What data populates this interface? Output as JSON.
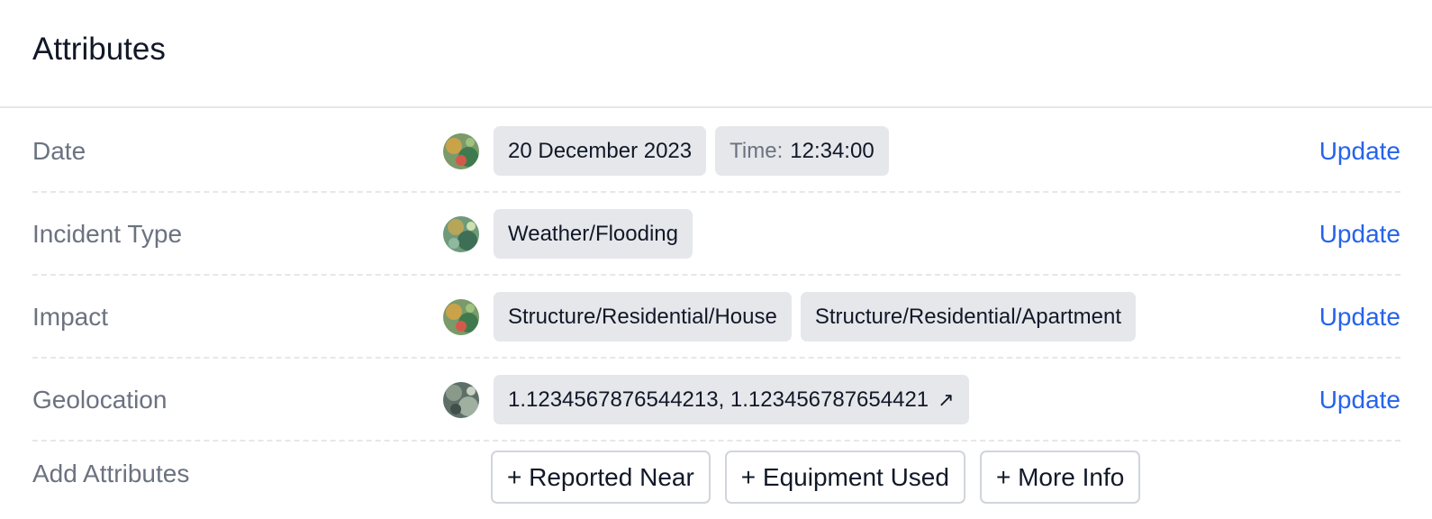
{
  "header": {
    "title": "Attributes"
  },
  "update_label": "Update",
  "rows": [
    {
      "label": "Date",
      "chips": [
        {
          "text": "20 December 2023"
        },
        {
          "prefix": "Time:",
          "text": "12:34:00"
        }
      ]
    },
    {
      "label": "Incident Type",
      "chips": [
        {
          "text": "Weather/Flooding"
        }
      ]
    },
    {
      "label": "Impact",
      "chips": [
        {
          "text": "Structure/Residential/House"
        },
        {
          "text": "Structure/Residential/Apartment"
        }
      ]
    },
    {
      "label": "Geolocation",
      "chips": [
        {
          "text": "1.1234567876544213, 1.123456787654421",
          "icon": "external-link-icon",
          "glyph": "↗"
        }
      ]
    }
  ],
  "add_attributes": {
    "label": "Add Attributes",
    "buttons": [
      "+ Reported Near",
      "+ Equipment Used",
      "+ More Info"
    ]
  },
  "colors": {
    "accent": "#2563eb",
    "chip_bg": "#e5e7eb",
    "label": "#6b7280",
    "text": "#111827"
  },
  "icons": {
    "avatar": "user-avatar-icon"
  }
}
